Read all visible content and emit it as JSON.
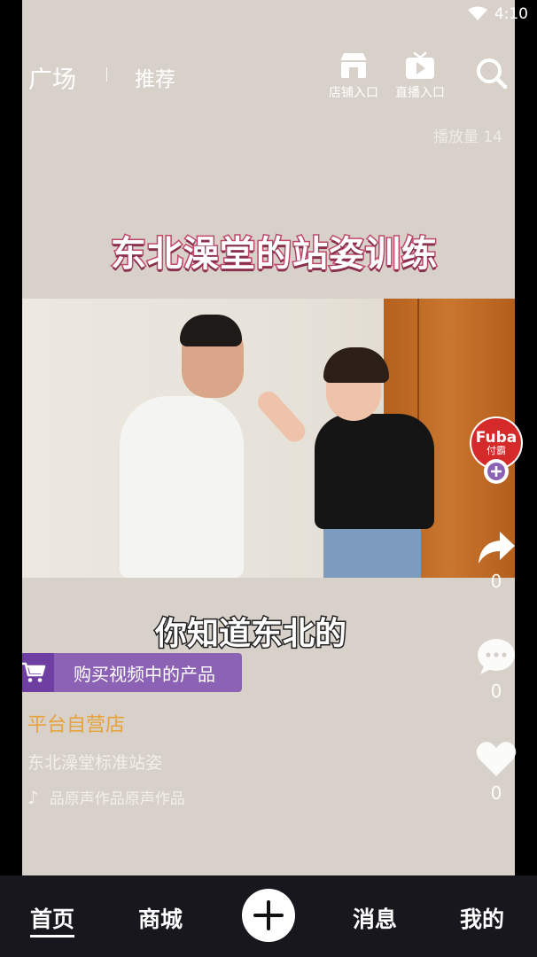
{
  "status": {
    "time": "4:10"
  },
  "header": {
    "tab_plaza": "广场",
    "tab_recommend": "推荐",
    "shop_entry": "店铺入口",
    "live_entry": "直播入口",
    "play_count": "播放量 14"
  },
  "video": {
    "title": "东北澡堂的站姿训练",
    "subtitle": "你知道东北的"
  },
  "product": {
    "buy_label": "购买视频中的产品"
  },
  "info": {
    "store": "平台自营店",
    "description": "东北澡堂标准站姿",
    "music": "品原声作品原声作品"
  },
  "side_actions": {
    "avatar_text": "Fuba",
    "avatar_sub": "付霸",
    "share_count": "0",
    "comment_count": "0",
    "like_count": "0"
  },
  "nav": {
    "home": "首页",
    "mall": "商城",
    "messages": "消息",
    "me": "我的"
  }
}
